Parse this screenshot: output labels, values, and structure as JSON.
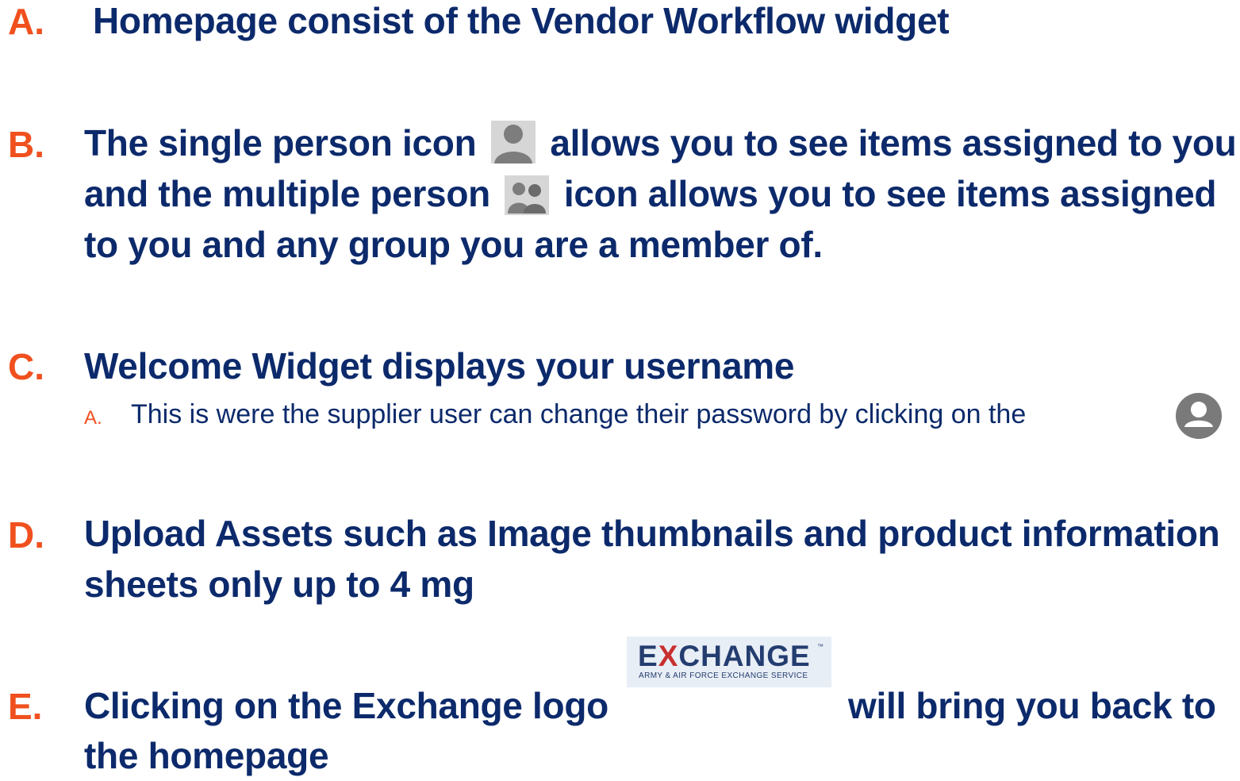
{
  "items": {
    "a": {
      "letter": "A.",
      "text": "Homepage consist of the Vendor Workflow widget"
    },
    "b": {
      "letter": "B.",
      "line1_before": "The single person icon",
      "line1_after": "allows you to see items assigned to you",
      "line2_before": "and the multiple person",
      "line2_after": "icon allows you to see items assigned",
      "line3": "to you and any group you are a member of."
    },
    "c": {
      "letter": "C.",
      "text": "Welcome Widget displays your username",
      "sub": {
        "letter": "A.",
        "text": "This is were the supplier user can change their password by clicking on the"
      }
    },
    "d": {
      "letter": "D.",
      "line1": "Upload Assets such as Image thumbnails and product information",
      "line2": "sheets only up to 4 mg"
    },
    "e": {
      "letter": "E.",
      "line1_before": "Clicking on the Exchange logo",
      "line1_after": "will bring you back to",
      "line2": "the homepage"
    }
  },
  "logo": {
    "main_before": "E",
    "main_x": "X",
    "main_after": "CHANGE",
    "tm": "™",
    "sub": "ARMY & AIR FORCE EXCHANGE SERVICE"
  },
  "icons": {
    "single_person": "single-person-icon",
    "multiple_person": "multiple-person-icon",
    "account": "account-circle-icon"
  },
  "colors": {
    "letter": "#f0501e",
    "text": "#0c2a6b"
  }
}
